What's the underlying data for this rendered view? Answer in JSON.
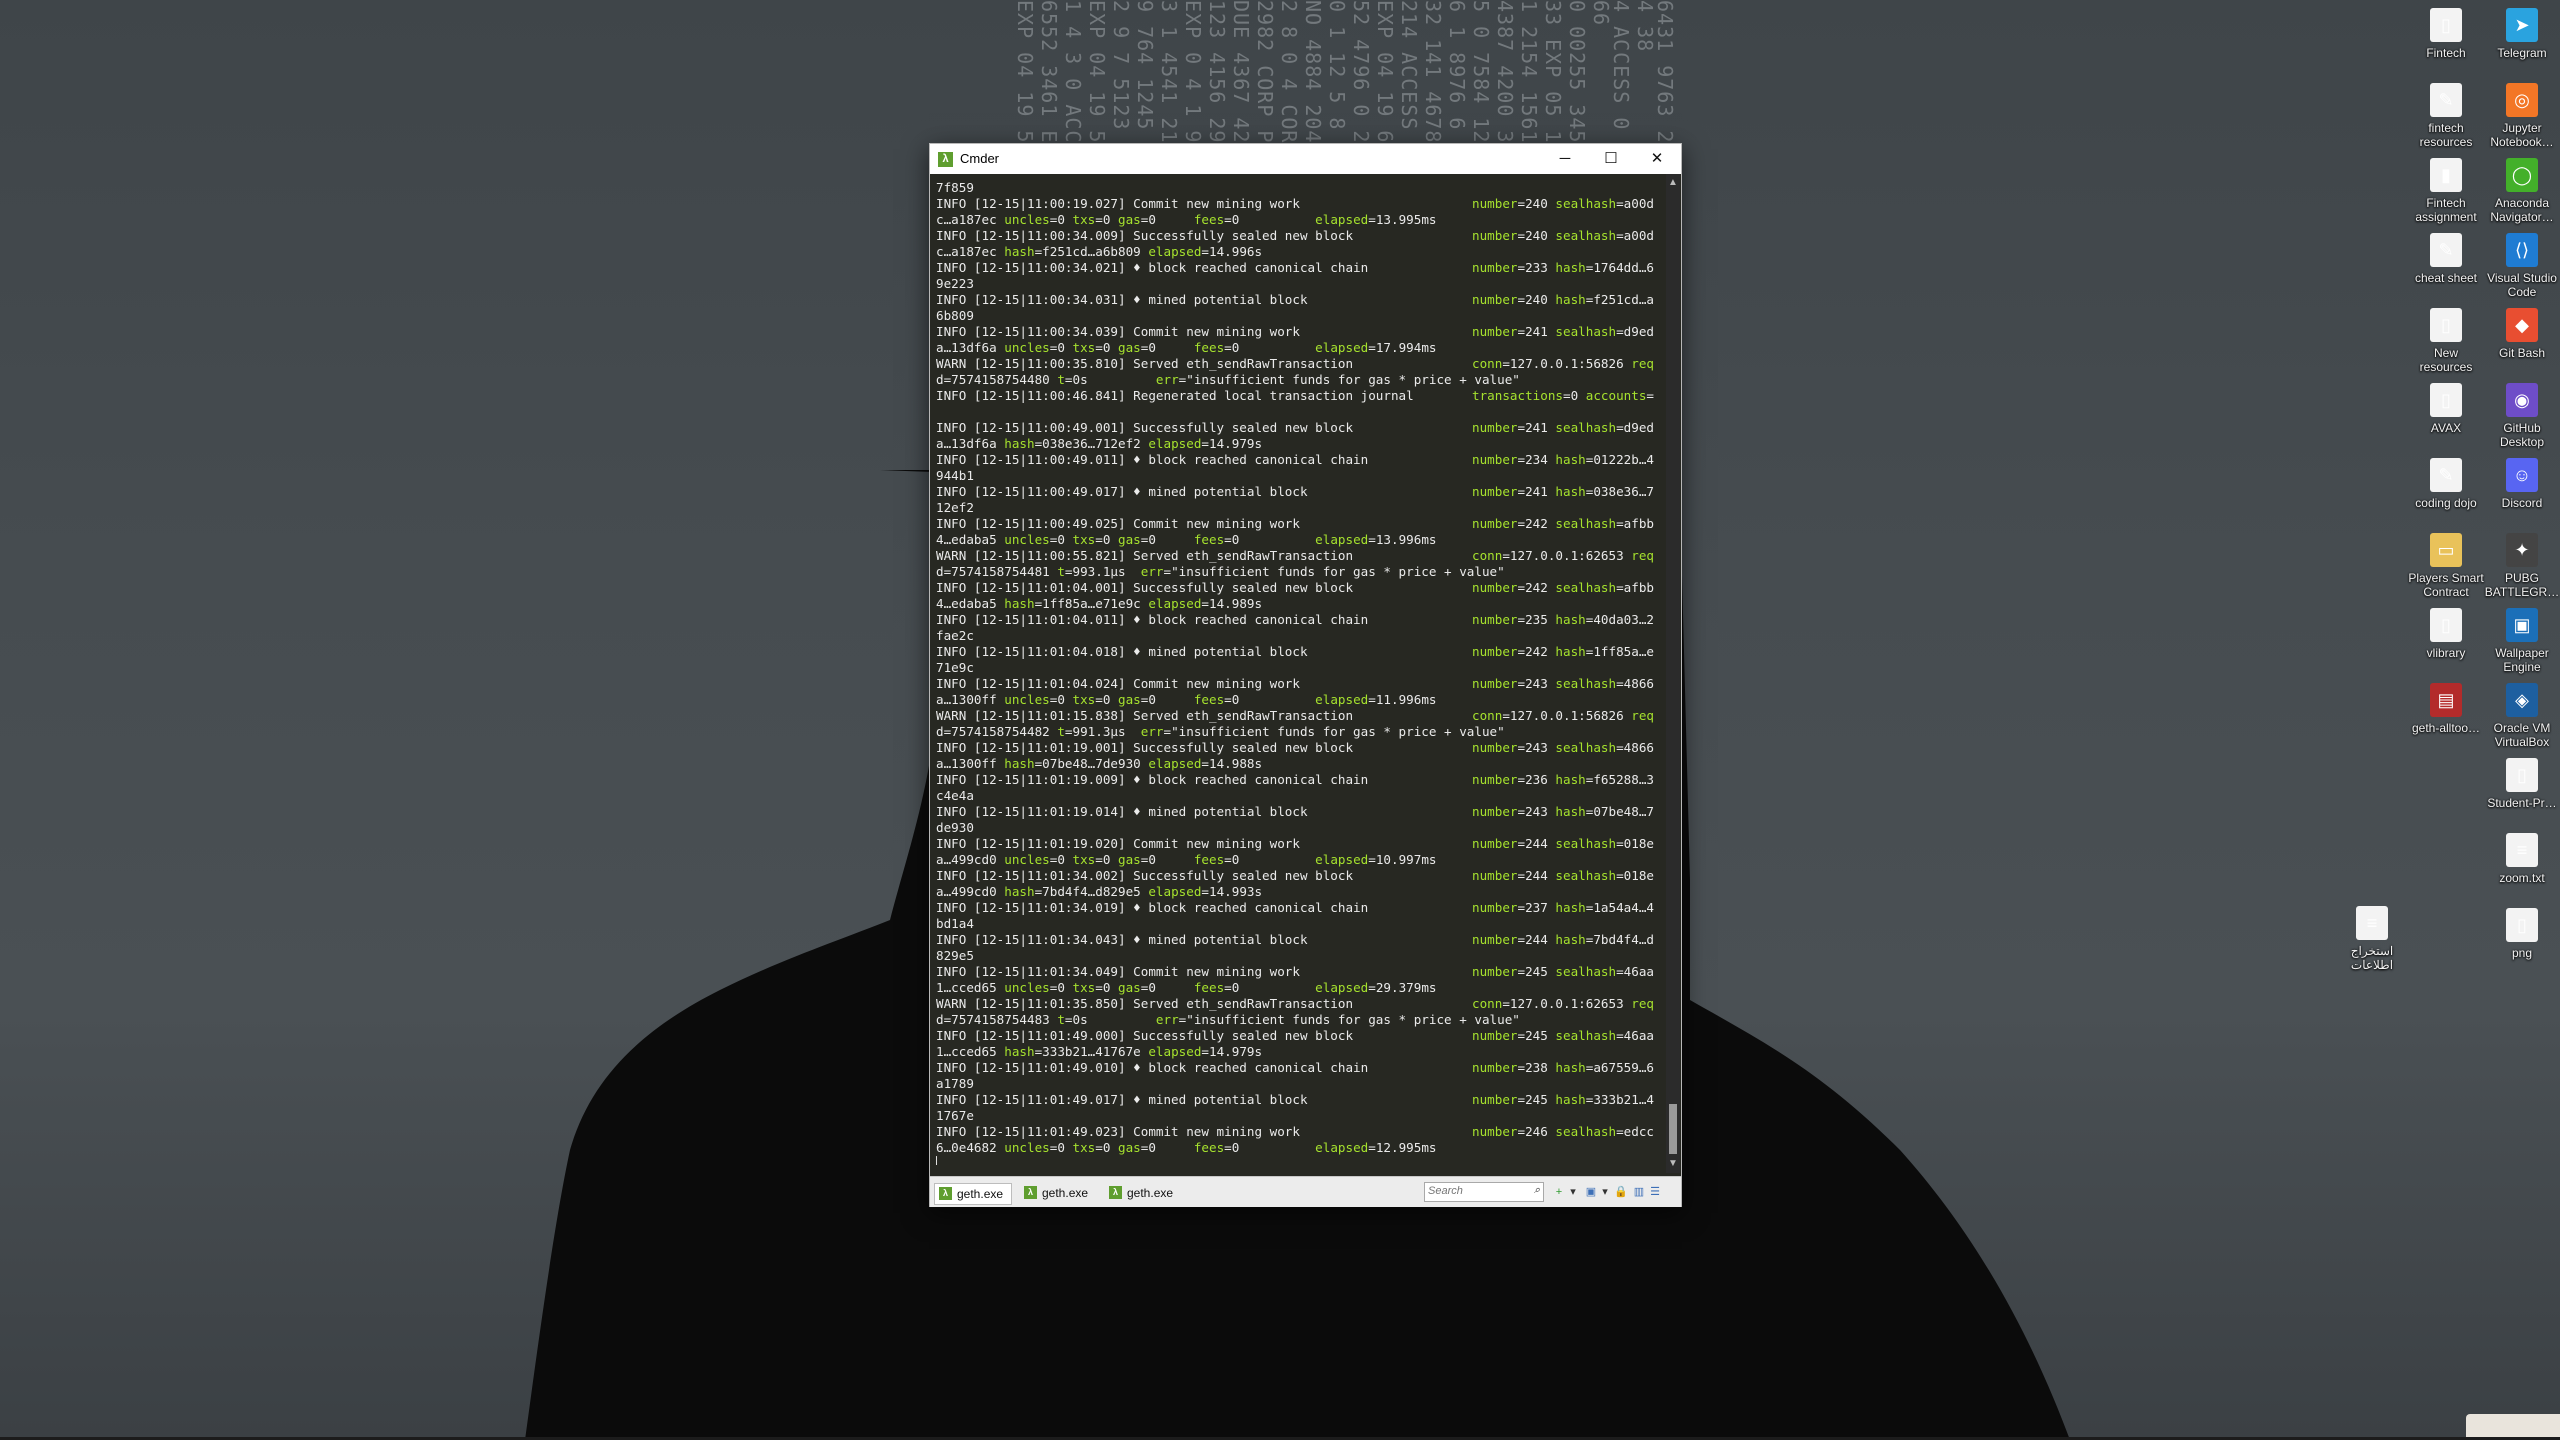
{
  "wallpaper": {
    "digit_columns": [
      "6431 9763 20 9764 1245 6 0 2475 ACCT 4 38",
      "4 ACCESS 0 6552 3461 EXP 0 4 1 2 5 66",
      "0 00255 3458 0 5 4541 2110 3 2",
      "33 EXP 05 16 0 9764 1245 6 0",
      "1 2154 1561 0 6552 3461",
      "4387 4200 37 4567 2110 3",
      "5 0 7584 12 7624 5 16 32 0",
      "6 1 8976 6 5123 BALANCE 0",
      "32 141 4678 3 62 0 04 19",
      "214 ACCESS 0 5522 4780",
      "EXP 04 19 6522 3461 0",
      "52 4796 0 2475 ACCT 4",
      "0 1 12 5 8 21 0 2",
      "NO 4884 2043 0",
      "2 8 0 4 CORP 1 8",
      "2982 CORP PAYMENT",
      "DUE 4367 4200 4",
      "123 4156 29 0",
      "EXP 0 4 1 9 4 5",
      "3 1 4541 2110 3",
      "9 764 1245 6",
      "2 9 7 5123 BALA",
      "EXP 04 19 5 2",
      "1 4 3 0 ACCE",
      "6552 3461 EX",
      "EXP 04 19 522"
    ]
  },
  "desktop_icons": [
    {
      "label": "Fintech",
      "glyph": "▯",
      "style": "g-doc"
    },
    {
      "label": "Telegram",
      "glyph": "➤",
      "style": "tg"
    },
    {
      "label": "fintech resources",
      "glyph": "✎",
      "style": "g-pdf"
    },
    {
      "label": "Jupyter Notebook…",
      "glyph": "◎",
      "style": "jup"
    },
    {
      "label": "Fintech assignment",
      "glyph": "▮",
      "style": "g-doc"
    },
    {
      "label": "Anaconda Navigator…",
      "glyph": "◯",
      "style": "ana"
    },
    {
      "label": "cheat sheet",
      "glyph": "✎",
      "style": "g-pdf"
    },
    {
      "label": "Visual Studio Code",
      "glyph": "⟨⟩",
      "style": "vs"
    },
    {
      "label": "New resources",
      "glyph": "▯",
      "style": "g-doc"
    },
    {
      "label": "Git Bash",
      "glyph": "◆",
      "style": "git"
    },
    {
      "label": "AVAX",
      "glyph": "▯",
      "style": "g-doc"
    },
    {
      "label": "GitHub Desktop",
      "glyph": "◉",
      "style": "gh"
    },
    {
      "label": "coding dojo",
      "glyph": "✎",
      "style": "g-pdf"
    },
    {
      "label": "Discord",
      "glyph": "☺",
      "style": "dc"
    },
    {
      "label": "Players Smart Contract",
      "glyph": "▭",
      "style": "g-folder"
    },
    {
      "label": "PUBG BATTLEGR…",
      "glyph": "✦",
      "style": "pubg"
    },
    {
      "label": "vlibrary",
      "glyph": "▯",
      "style": "g-doc"
    },
    {
      "label": "Wallpaper Engine",
      "glyph": "▣",
      "style": "we"
    },
    {
      "label": "geth-alltoo…",
      "glyph": "▤",
      "style": "rar"
    },
    {
      "label": "Oracle VM VirtualBox",
      "glyph": "◈",
      "style": "vb"
    },
    {
      "label": "Student-Pr…",
      "glyph": "▯",
      "style": "g-doc"
    },
    {
      "label": "zoom.txt",
      "glyph": "≡",
      "style": "g-doc"
    },
    {
      "label": "استخراج اطلاعات",
      "glyph": "≡",
      "style": "g-doc"
    },
    {
      "label": "png",
      "glyph": "▯",
      "style": "g-doc"
    }
  ],
  "window": {
    "title": "Cmder",
    "minimize": "─",
    "maximize": "☐",
    "close": "✕"
  },
  "console_lines": [
    {
      "t": "7f859"
    },
    {
      "lv": "INFO",
      "msg": " [12-15|11:00:19.027] Commit new mining work",
      "rk": "number",
      "rv": "=240 ",
      "rk2": "sealhash",
      "rv2": "=a00d"
    },
    {
      "t": "c…a187ec ",
      "k1": "uncles",
      "v1": "=0 ",
      "k2": "txs",
      "v2": "=0 ",
      "k3": "gas",
      "v3": "=0     ",
      "k4": "fees",
      "v4": "=0          ",
      "k5": "elapsed",
      "v5": "=13.995ms"
    },
    {
      "lv": "INFO",
      "msg": " [12-15|11:00:34.009] Successfully sealed new block",
      "rk": "number",
      "rv": "=240 ",
      "rk2": "sealhash",
      "rv2": "=a00d"
    },
    {
      "t": "c…a187ec ",
      "k1": "hash",
      "v1": "=f251cd…a6b809 ",
      "k5": "elapsed",
      "v5": "=14.996s"
    },
    {
      "lv": "INFO",
      "msg": " [12-15|11:00:34.021] ♦ block reached canonical chain",
      "rk": "number",
      "rv": "=233 ",
      "rk2": "hash",
      "rv2": "=1764dd…6"
    },
    {
      "t": "9e223"
    },
    {
      "lv": "INFO",
      "msg": " [12-15|11:00:34.031] ♦ mined potential block",
      "rk": "number",
      "rv": "=240 ",
      "rk2": "hash",
      "rv2": "=f251cd…a"
    },
    {
      "t": "6b809"
    },
    {
      "lv": "INFO",
      "msg": " [12-15|11:00:34.039] Commit new mining work",
      "rk": "number",
      "rv": "=241 ",
      "rk2": "sealhash",
      "rv2": "=d9ed"
    },
    {
      "t": "a…13df6a ",
      "k1": "uncles",
      "v1": "=0 ",
      "k2": "txs",
      "v2": "=0 ",
      "k3": "gas",
      "v3": "=0     ",
      "k4": "fees",
      "v4": "=0          ",
      "k5": "elapsed",
      "v5": "=17.994ms"
    },
    {
      "lv": "WARN",
      "msg": " [12-15|11:00:35.810] Served eth_sendRawTransaction",
      "rk": "conn",
      "rv": "=127.0.0.1:56826 ",
      "rk2": "req",
      "rv2": ""
    },
    {
      "t": "d=7574158754480 ",
      "k1": "t",
      "v1": "=0s         ",
      "k2": "err",
      "v2": "=\"insufficient funds for gas * price + value\""
    },
    {
      "lv": "INFO",
      "msg": " [12-15|11:00:46.841] Regenerated local transaction journal",
      "rk": "transactions",
      "rv": "=0 ",
      "rk2": "accounts",
      "rv2": "="
    },
    {
      "t": ""
    },
    {
      "lv": "INFO",
      "msg": " [12-15|11:00:49.001] Successfully sealed new block",
      "rk": "number",
      "rv": "=241 ",
      "rk2": "sealhash",
      "rv2": "=d9ed"
    },
    {
      "t": "a…13df6a ",
      "k1": "hash",
      "v1": "=038e36…712ef2 ",
      "k5": "elapsed",
      "v5": "=14.979s"
    },
    {
      "lv": "INFO",
      "msg": " [12-15|11:00:49.011] ♦ block reached canonical chain",
      "rk": "number",
      "rv": "=234 ",
      "rk2": "hash",
      "rv2": "=01222b…4"
    },
    {
      "t": "944b1"
    },
    {
      "lv": "INFO",
      "msg": " [12-15|11:00:49.017] ♦ mined potential block",
      "rk": "number",
      "rv": "=241 ",
      "rk2": "hash",
      "rv2": "=038e36…7"
    },
    {
      "t": "12ef2"
    },
    {
      "lv": "INFO",
      "msg": " [12-15|11:00:49.025] Commit new mining work",
      "rk": "number",
      "rv": "=242 ",
      "rk2": "sealhash",
      "rv2": "=afbb"
    },
    {
      "t": "4…edaba5 ",
      "k1": "uncles",
      "v1": "=0 ",
      "k2": "txs",
      "v2": "=0 ",
      "k3": "gas",
      "v3": "=0     ",
      "k4": "fees",
      "v4": "=0          ",
      "k5": "elapsed",
      "v5": "=13.996ms"
    },
    {
      "lv": "WARN",
      "msg": " [12-15|11:00:55.821] Served eth_sendRawTransaction",
      "rk": "conn",
      "rv": "=127.0.0.1:62653 ",
      "rk2": "req",
      "rv2": ""
    },
    {
      "t": "d=7574158754481 ",
      "k1": "t",
      "v1": "=993.1µs  ",
      "k2": "err",
      "v2": "=\"insufficient funds for gas * price + value\""
    },
    {
      "lv": "INFO",
      "msg": " [12-15|11:01:04.001] Successfully sealed new block",
      "rk": "number",
      "rv": "=242 ",
      "rk2": "sealhash",
      "rv2": "=afbb"
    },
    {
      "t": "4…edaba5 ",
      "k1": "hash",
      "v1": "=1ff85a…e71e9c ",
      "k5": "elapsed",
      "v5": "=14.989s"
    },
    {
      "lv": "INFO",
      "msg": " [12-15|11:01:04.011] ♦ block reached canonical chain",
      "rk": "number",
      "rv": "=235 ",
      "rk2": "hash",
      "rv2": "=40da03…2"
    },
    {
      "t": "fae2c"
    },
    {
      "lv": "INFO",
      "msg": " [12-15|11:01:04.018] ♦ mined potential block",
      "rk": "number",
      "rv": "=242 ",
      "rk2": "hash",
      "rv2": "=1ff85a…e"
    },
    {
      "t": "71e9c"
    },
    {
      "lv": "INFO",
      "msg": " [12-15|11:01:04.024] Commit new mining work",
      "rk": "number",
      "rv": "=243 ",
      "rk2": "sealhash",
      "rv2": "=4866"
    },
    {
      "t": "a…1300ff ",
      "k1": "uncles",
      "v1": "=0 ",
      "k2": "txs",
      "v2": "=0 ",
      "k3": "gas",
      "v3": "=0     ",
      "k4": "fees",
      "v4": "=0          ",
      "k5": "elapsed",
      "v5": "=11.996ms"
    },
    {
      "lv": "WARN",
      "msg": " [12-15|11:01:15.838] Served eth_sendRawTransaction",
      "rk": "conn",
      "rv": "=127.0.0.1:56826 ",
      "rk2": "req",
      "rv2": ""
    },
    {
      "t": "d=7574158754482 ",
      "k1": "t",
      "v1": "=991.3µs  ",
      "k2": "err",
      "v2": "=\"insufficient funds for gas * price + value\""
    },
    {
      "lv": "INFO",
      "msg": " [12-15|11:01:19.001] Successfully sealed new block",
      "rk": "number",
      "rv": "=243 ",
      "rk2": "sealhash",
      "rv2": "=4866"
    },
    {
      "t": "a…1300ff ",
      "k1": "hash",
      "v1": "=07be48…7de930 ",
      "k5": "elapsed",
      "v5": "=14.988s"
    },
    {
      "lv": "INFO",
      "msg": " [12-15|11:01:19.009] ♦ block reached canonical chain",
      "rk": "number",
      "rv": "=236 ",
      "rk2": "hash",
      "rv2": "=f65288…3"
    },
    {
      "t": "c4e4a"
    },
    {
      "lv": "INFO",
      "msg": " [12-15|11:01:19.014] ♦ mined potential block",
      "rk": "number",
      "rv": "=243 ",
      "rk2": "hash",
      "rv2": "=07be48…7"
    },
    {
      "t": "de930"
    },
    {
      "lv": "INFO",
      "msg": " [12-15|11:01:19.020] Commit new mining work",
      "rk": "number",
      "rv": "=244 ",
      "rk2": "sealhash",
      "rv2": "=018e"
    },
    {
      "t": "a…499cd0 ",
      "k1": "uncles",
      "v1": "=0 ",
      "k2": "txs",
      "v2": "=0 ",
      "k3": "gas",
      "v3": "=0     ",
      "k4": "fees",
      "v4": "=0          ",
      "k5": "elapsed",
      "v5": "=10.997ms"
    },
    {
      "lv": "INFO",
      "msg": " [12-15|11:01:34.002] Successfully sealed new block",
      "rk": "number",
      "rv": "=244 ",
      "rk2": "sealhash",
      "rv2": "=018e"
    },
    {
      "t": "a…499cd0 ",
      "k1": "hash",
      "v1": "=7bd4f4…d829e5 ",
      "k5": "elapsed",
      "v5": "=14.993s"
    },
    {
      "lv": "INFO",
      "msg": " [12-15|11:01:34.019] ♦ block reached canonical chain",
      "rk": "number",
      "rv": "=237 ",
      "rk2": "hash",
      "rv2": "=1a54a4…4"
    },
    {
      "t": "bd1a4"
    },
    {
      "lv": "INFO",
      "msg": " [12-15|11:01:34.043] ♦ mined potential block",
      "rk": "number",
      "rv": "=244 ",
      "rk2": "hash",
      "rv2": "=7bd4f4…d"
    },
    {
      "t": "829e5"
    },
    {
      "lv": "INFO",
      "msg": " [12-15|11:01:34.049] Commit new mining work",
      "rk": "number",
      "rv": "=245 ",
      "rk2": "sealhash",
      "rv2": "=46aa"
    },
    {
      "t": "1…cced65 ",
      "k1": "uncles",
      "v1": "=0 ",
      "k2": "txs",
      "v2": "=0 ",
      "k3": "gas",
      "v3": "=0     ",
      "k4": "fees",
      "v4": "=0          ",
      "k5": "elapsed",
      "v5": "=29.379ms"
    },
    {
      "lv": "WARN",
      "msg": " [12-15|11:01:35.850] Served eth_sendRawTransaction",
      "rk": "conn",
      "rv": "=127.0.0.1:62653 ",
      "rk2": "req",
      "rv2": ""
    },
    {
      "t": "d=7574158754483 ",
      "k1": "t",
      "v1": "=0s         ",
      "k2": "err",
      "v2": "=\"insufficient funds for gas * price + value\""
    },
    {
      "lv": "INFO",
      "msg": " [12-15|11:01:49.000] Successfully sealed new block",
      "rk": "number",
      "rv": "=245 ",
      "rk2": "sealhash",
      "rv2": "=46aa"
    },
    {
      "t": "1…cced65 ",
      "k1": "hash",
      "v1": "=333b21…41767e ",
      "k5": "elapsed",
      "v5": "=14.979s"
    },
    {
      "lv": "INFO",
      "msg": " [12-15|11:01:49.010] ♦ block reached canonical chain",
      "rk": "number",
      "rv": "=238 ",
      "rk2": "hash",
      "rv2": "=a67559…6"
    },
    {
      "t": "a1789"
    },
    {
      "lv": "INFO",
      "msg": " [12-15|11:01:49.017] ♦ mined potential block",
      "rk": "number",
      "rv": "=245 ",
      "rk2": "hash",
      "rv2": "=333b21…4"
    },
    {
      "t": "1767e"
    },
    {
      "lv": "INFO",
      "msg": " [12-15|11:01:49.023] Commit new mining work",
      "rk": "number",
      "rv": "=246 ",
      "rk2": "sealhash",
      "rv2": "=edcc"
    },
    {
      "t": "6…0e4682 ",
      "k1": "uncles",
      "v1": "=0 ",
      "k2": "txs",
      "v2": "=0 ",
      "k3": "gas",
      "v3": "=0     ",
      "k4": "fees",
      "v4": "=0          ",
      "k5": "elapsed",
      "v5": "=12.995ms"
    },
    {
      "t": "▏"
    }
  ],
  "tabs": [
    {
      "label": "geth.exe",
      "icon": "λ",
      "active": true
    },
    {
      "label": "geth.exe",
      "icon": "λ",
      "active": false
    },
    {
      "label": "geth.exe",
      "icon": "λ",
      "active": false
    }
  ],
  "search": {
    "placeholder": "Search",
    "icon": "⌕"
  },
  "toolbar_icons": [
    {
      "name": "new-console-icon",
      "glyph": "+",
      "color": "#2e9b2e"
    },
    {
      "name": "dropdown-icon",
      "glyph": "▾",
      "color": "#333"
    },
    {
      "name": "split-view-icon",
      "glyph": "▣",
      "color": "#3d6fb7"
    },
    {
      "name": "dropdown-icon",
      "glyph": "▾",
      "color": "#333"
    },
    {
      "name": "lock-icon",
      "glyph": "🔒",
      "color": "#c69c1d"
    },
    {
      "name": "pane-icon",
      "glyph": "▥",
      "color": "#3d6fb7"
    },
    {
      "name": "menu-icon",
      "glyph": "☰",
      "color": "#3d6fb7"
    }
  ],
  "colors": {
    "accent_green": "#a6e22e",
    "console_bg": "#272822",
    "text": "#eaeaea"
  }
}
